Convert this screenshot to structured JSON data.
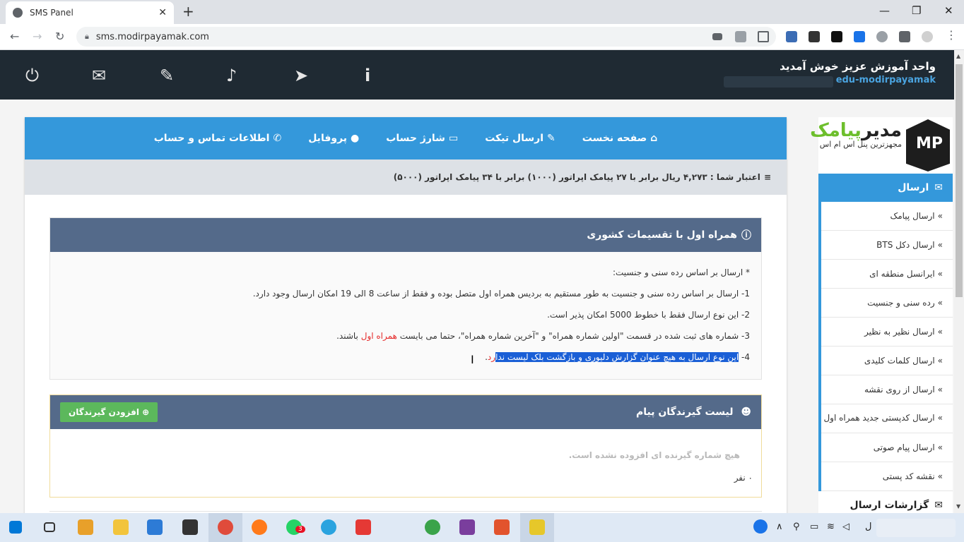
{
  "browser": {
    "tab_title": "SMS Panel",
    "tab_close": "✕",
    "new_tab": "+",
    "url": "sms.modirpayamak.com",
    "window_controls": [
      "—",
      "❐",
      "✕"
    ],
    "nav": [
      "←",
      "→",
      "↻"
    ]
  },
  "header": {
    "welcome": "واحد آموزش عزیز خوش آمدید",
    "username": "edu-modirpayamak -",
    "icons": [
      "power-icon",
      "mail-icon",
      "ticket-icon",
      "bell-icon",
      "send-icon",
      "info-icon"
    ]
  },
  "topnav": {
    "items": [
      {
        "label": "صفحه نخست",
        "icon": "⌂"
      },
      {
        "label": "ارسال تیکت",
        "icon": "✎"
      },
      {
        "label": "شارژ حساب",
        "icon": "▭"
      },
      {
        "label": "پروفایل",
        "icon": "●"
      },
      {
        "label": "اطلاعات تماس و حساب",
        "icon": "✆"
      }
    ]
  },
  "credit": {
    "text": "اعتبار شما : ۴,۲۷۳ ریال برابر با ۲۷ پیامک اپراتور (۱۰۰۰) برابر با ۳۴ پیامک اپراتور (۵۰۰۰)"
  },
  "info_panel": {
    "title": "همراه اول با تقسیمات کشوری",
    "line0": "* ارسال بر اساس رده سنی و جنسیت:",
    "line1": "1- ارسال بر اساس رده سنی و جنسیت به طور مستقیم به بردیس همراه اول متصل بوده و فقط از ساعت 8 الی 19 امکان ارسال وجود دارد.",
    "line2": "2- این نوع ارسال فقط با خطوط 5000 امکان پذیر است.",
    "line3_a": "3- شماره های ثبت شده در قسمت \"اولین شماره همراه\" و \"آخرین شماره همراه\"، حتما می بایست ",
    "line3_red": "همراه اول",
    "line3_b": " باشند.",
    "line4_prefix": "4- ",
    "line4_hl": "این نوع ارسال به هیچ عنوان گزارش دلیوری و بازگشت بلک لیست ندا",
    "line4_red": "رد",
    "line4_end": "."
  },
  "recipients_panel": {
    "title": "لیست گیرندگان پیام",
    "add_button": "افزودن گیرندگان",
    "empty_text": "هیچ شماره گیرنده ای افزوده نشده است.",
    "count_text": "۰ نفر"
  },
  "sidebar": {
    "logo_title_a": "مدیر",
    "logo_title_b": "پیامک",
    "logo_subtitle": "مجهزترین پنل اس ام اس",
    "logo_mark": "MP",
    "section_title": "ارسال",
    "items": [
      "ارسال پیامک",
      "ارسال دکل BTS",
      "ایرانسل منطقه ای",
      "رده سنی و جنسیت",
      "ارسال نظیر به نظیر",
      "ارسال کلمات کلیدی",
      "ارسال از روی نقشه",
      "ارسال کدپستی جدید همراه اول",
      "ارسال پیام صوتی",
      "نقشه کد پستی"
    ],
    "section2_title": "گزارشات ارسال"
  },
  "taskbar": {
    "badge": "3",
    "tray_lang": "ل"
  },
  "colors": {
    "accent": "#3498db",
    "dark_header": "#1f2a33",
    "panel_head": "#546a8a",
    "success": "#5cb85c",
    "highlight": "#1a5fd6"
  }
}
